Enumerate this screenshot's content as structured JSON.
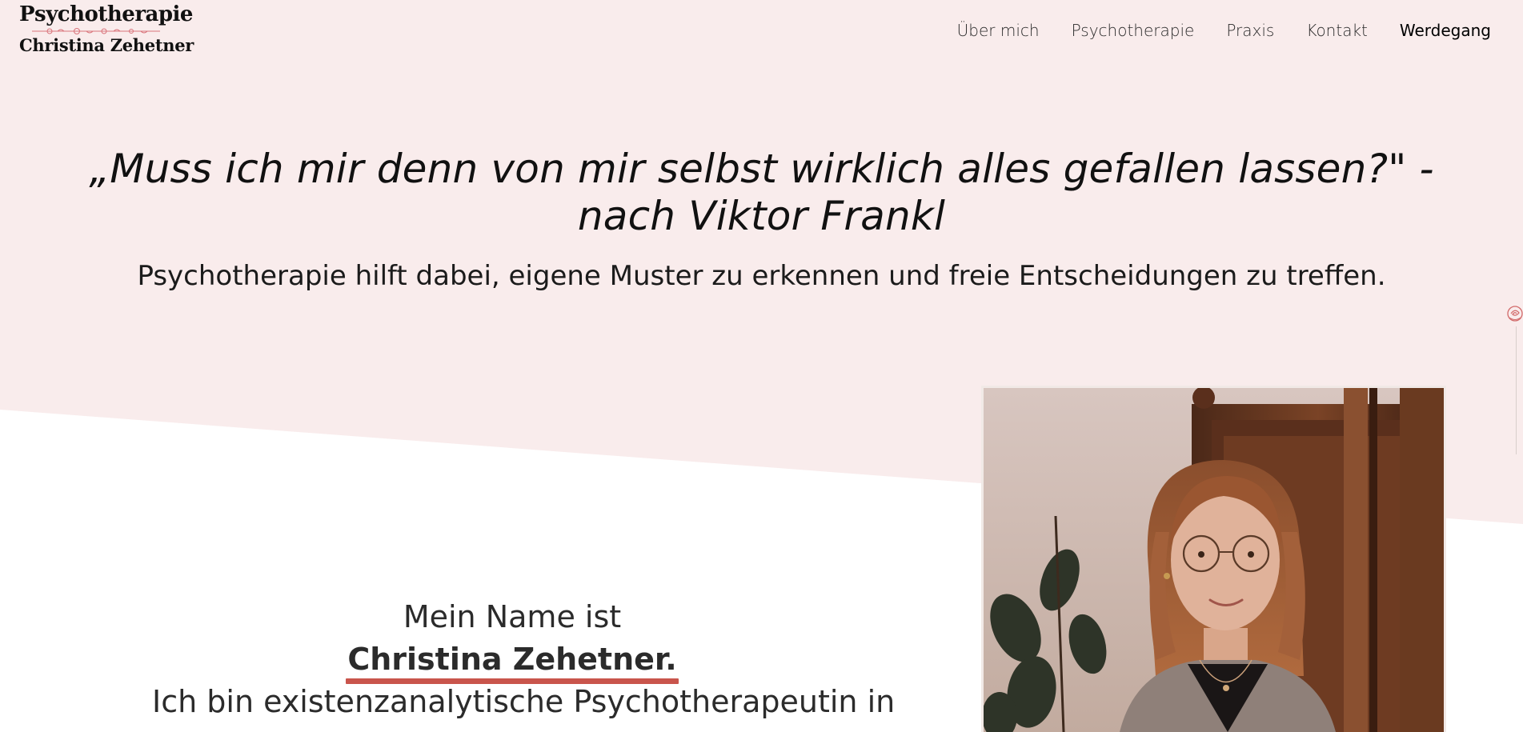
{
  "brand": {
    "title_line1": "Psychotherapie",
    "title_line2": "Christina Zehetner",
    "accent_color": "#c9554c",
    "hero_bg_color": "#f9ecec"
  },
  "nav": {
    "items": [
      {
        "label": "Über mich"
      },
      {
        "label": "Psychotherapie"
      },
      {
        "label": "Praxis"
      },
      {
        "label": "Kontakt"
      },
      {
        "label": "Werdegang"
      }
    ]
  },
  "hero": {
    "quote": "„Muss ich mir denn von mir selbst wirklich alles gefallen lassen?\" - nach Viktor Frankl",
    "subline": "Psychotherapie hilft dabei, eigene Muster zu erkennen und freie Entscheidungen zu treffen."
  },
  "about": {
    "line1": "Mein Name ist",
    "name": "Christina Zehetner.",
    "line3": "Ich bin existenzanalytische Psychotherapeutin in",
    "portrait_icon": "portrait-photo"
  },
  "icons": {
    "scroll_rose": "rose-icon",
    "logo_ornament": "rose-vine-ornament"
  }
}
